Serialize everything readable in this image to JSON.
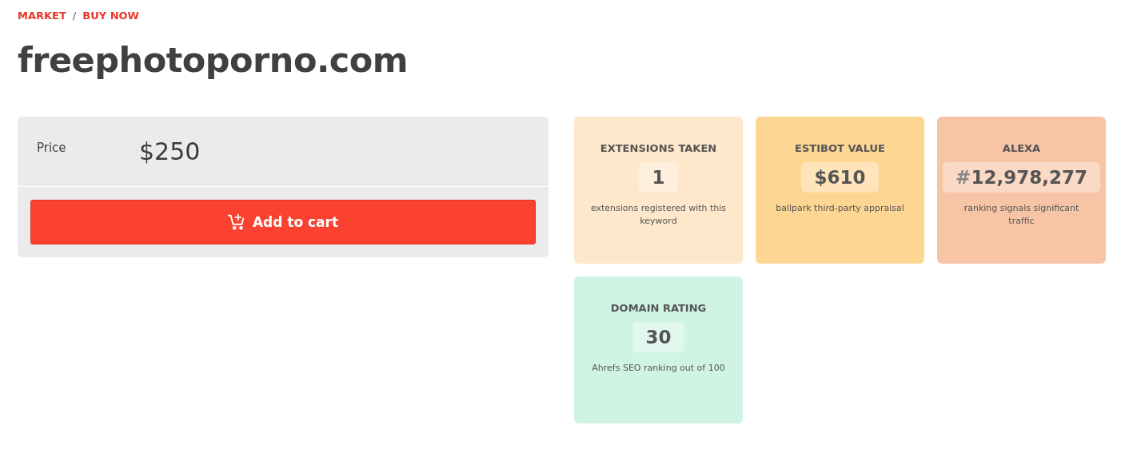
{
  "breadcrumb": [
    {
      "label": "MARKET"
    },
    {
      "label": "BUY NOW"
    }
  ],
  "breadcrumb_separator": "/",
  "title": "freephotoporno.com",
  "purchase": {
    "price_label": "Price",
    "price": "$250",
    "button": "Add to cart"
  },
  "stats": [
    {
      "title": "EXTENSIONS TAKEN",
      "value": "1",
      "description": "extensions registered with this keyword",
      "color": "#fee8cb"
    },
    {
      "title": "ESTIBOT VALUE",
      "value": "$610",
      "description": "ballpark third-party appraisal",
      "color": "#fed693"
    },
    {
      "title": "ALEXA",
      "prefix": "#",
      "value": "12,978,277",
      "description": "ranking signals significant traffic",
      "color": "#f7c5a6"
    },
    {
      "title": "DOMAIN RATING",
      "value": "30",
      "description": "Ahrefs SEO ranking out of 100",
      "color": "#cff4e3"
    }
  ]
}
